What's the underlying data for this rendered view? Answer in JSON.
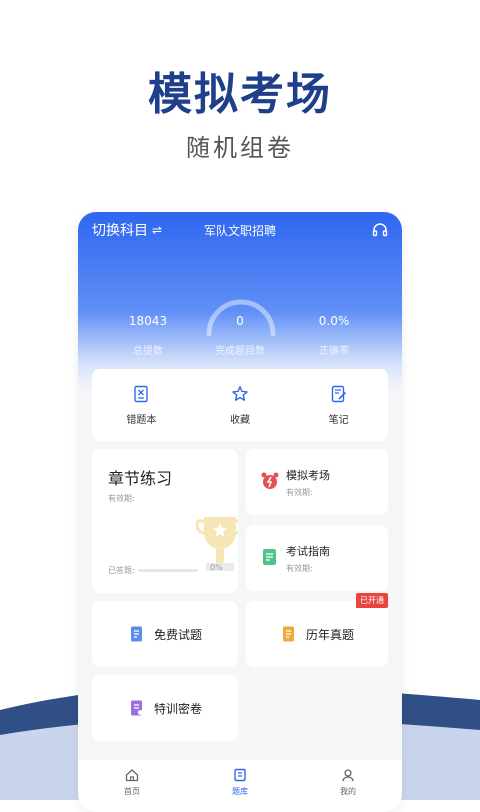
{
  "hero": {
    "title": "模拟考场",
    "subtitle": "随机组卷"
  },
  "header": {
    "switch_label": "切换科目",
    "switch_icon": "⇌",
    "title": "军队文职招聘"
  },
  "stats": [
    {
      "value": "18043",
      "label": "总提数"
    },
    {
      "value": "0",
      "label": "完成题目数"
    },
    {
      "value": "0.0%",
      "label": "正确率"
    }
  ],
  "quick": [
    {
      "label": "错题本",
      "icon": "wrong-book-icon"
    },
    {
      "label": "收藏",
      "icon": "star-icon"
    },
    {
      "label": "笔记",
      "icon": "note-icon"
    }
  ],
  "chapter": {
    "title": "章节练习",
    "validity": "有效期:",
    "answered": "已答题:",
    "percent": "0%",
    "progress": 0
  },
  "mock": {
    "title": "模拟考场",
    "validity": "有效期:"
  },
  "guide": {
    "title": "考试指南",
    "validity": "有效期:"
  },
  "free": {
    "label": "免费试题"
  },
  "past": {
    "label": "历年真题",
    "badge": "已开通"
  },
  "secret": {
    "label": "特训密卷"
  },
  "tabs": [
    {
      "label": "首页"
    },
    {
      "label": "题库"
    },
    {
      "label": "我的"
    }
  ],
  "colors": {
    "primary": "#2f66f0",
    "hero_title": "#1f3f8a",
    "badge": "#e8453c"
  }
}
